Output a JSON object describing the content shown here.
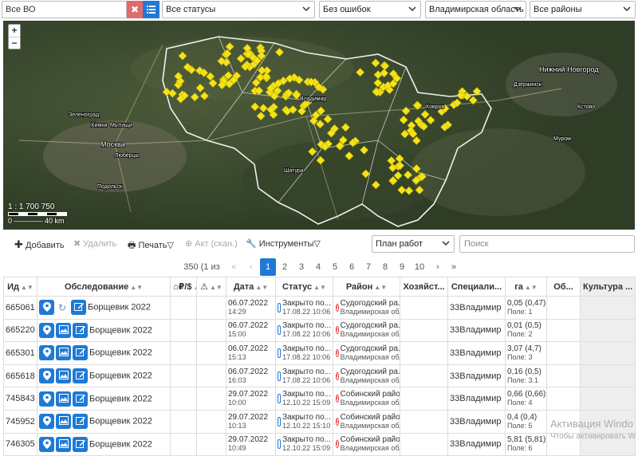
{
  "filters": {
    "vo_value": "Все ВО",
    "clear_icon": "times-icon",
    "list_icon": "list-icon",
    "status": "Все статусы",
    "errors": "Без ошибок",
    "region": "Владимирская область",
    "districts": "Все районы"
  },
  "map": {
    "zoom_in": "+",
    "zoom_out": "−",
    "scale": "1 : 1 700 750",
    "scale_km": "0 ———— 40 km",
    "marker_color": "#f5e31a",
    "labels": [
      "Москва",
      "Химки",
      "Мытищи",
      "Зеленоград",
      "Люберцы",
      "Подольск",
      "Нижний Новгород",
      "Дзержинск",
      "Кстово",
      "Муром",
      "Ковров",
      "Владимир",
      "Шатура"
    ]
  },
  "toolbar": {
    "add": "Добавить",
    "delete": "Удалить",
    "print": "Печать",
    "act": "Акт (скан.)",
    "tools": "Инструменты",
    "plan": "План работ",
    "search_placeholder": "Поиск"
  },
  "pager": {
    "summary": "350 (1 из 14)",
    "first": "«",
    "prev": "‹",
    "pages": [
      "1",
      "2",
      "3",
      "4",
      "5",
      "6",
      "7",
      "8",
      "9",
      "10"
    ],
    "next": "›",
    "last": "»"
  },
  "table": {
    "headers": {
      "id": "Ид",
      "survey": "Обследование",
      "money": "₽/$",
      "warn": "⚠",
      "date": "Дата",
      "status": "Статус",
      "district": "Район",
      "owner": "Хозяйст...",
      "spec": "Специали...",
      "ha": "га",
      "ob": "Об...",
      "culture": "Культура ..."
    },
    "rows": [
      {
        "id": "665061",
        "survey": "Борщевик 2022",
        "date": "06.07.2022",
        "time": "14:29",
        "status": "Закрыто по...",
        "status_date": "17.08.22 10:06",
        "district": "Судогодский ра...",
        "region": "Владимирская обла...",
        "spec": "33Владимир",
        "ha": "0,05 (0,47)",
        "fields": "Поле: 1",
        "has_refresh": true
      },
      {
        "id": "665220",
        "survey": "Борщевик 2022",
        "date": "06.07.2022",
        "time": "15:00",
        "status": "Закрыто по...",
        "status_date": "17.08.22 10:06",
        "district": "Судогодский ра...",
        "region": "Владимирская обла...",
        "spec": "33Владимир",
        "ha": "0,01 (0,5)",
        "fields": "Поле: 2",
        "has_refresh": false
      },
      {
        "id": "665301",
        "survey": "Борщевик 2022",
        "date": "06.07.2022",
        "time": "15:13",
        "status": "Закрыто по...",
        "status_date": "17.08.22 10:06",
        "district": "Судогодский ра...",
        "region": "Владимирская обла...",
        "spec": "33Владимир",
        "ha": "3,07 (4,7)",
        "fields": "Поле: 3",
        "has_refresh": false
      },
      {
        "id": "665618",
        "survey": "Борщевик 2022",
        "date": "06.07.2022",
        "time": "16:03",
        "status": "Закрыто по...",
        "status_date": "17.08.22 10:06",
        "district": "Судогодский ра...",
        "region": "Владимирская обла...",
        "spec": "33Владимир",
        "ha": "0,16 (0,5)",
        "fields": "Поле: 3.1",
        "has_refresh": false
      },
      {
        "id": "745843",
        "survey": "Борщевик 2022",
        "date": "29.07.2022",
        "time": "10:00",
        "status": "Закрыто по...",
        "status_date": "12.10.22 15:09",
        "district": "Собинский район",
        "region": "Владимирская обла...",
        "spec": "33Владимир",
        "ha": "0,66 (0,66)",
        "fields": "Поле: 4",
        "has_refresh": false
      },
      {
        "id": "745952",
        "survey": "Борщевик 2022",
        "date": "29.07.2022",
        "time": "10:13",
        "status": "Закрыто по...",
        "status_date": "12.10.22 15:10",
        "district": "Собинский район",
        "region": "Владимирская обла...",
        "spec": "33Владимир",
        "ha": "0,4 (0,4)",
        "fields": "Поле: 5",
        "has_refresh": false
      },
      {
        "id": "746305",
        "survey": "Борщевик 2022",
        "date": "29.07.2022",
        "time": "10:49",
        "status": "Закрыто по...",
        "status_date": "12.10.22 15:09",
        "district": "Собинский район",
        "region": "Владимирская обла...",
        "spec": "33Владимир",
        "ha": "5,81 (5,81)",
        "fields": "Поле: 6",
        "has_refresh": false
      }
    ]
  },
  "watermark": {
    "line1": "Активация Windo",
    "line2": "Чтобы активировать W"
  }
}
